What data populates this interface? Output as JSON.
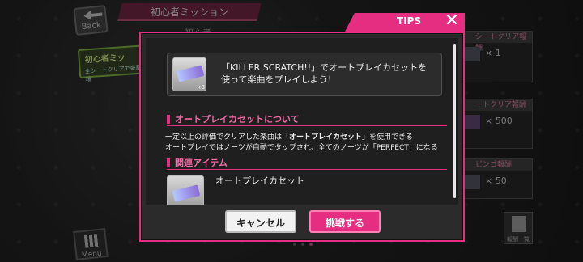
{
  "background": {
    "back_label": "Back",
    "title": "初心者ミッション",
    "subtitle": "初心者",
    "left_tag": {
      "title": "初心者ミッ",
      "sub": "全シートクリアで豪華報"
    },
    "rewards": [
      {
        "header": "シートクリア報酬",
        "value": "× 1"
      },
      {
        "header": "ートクリア報酬",
        "value": "× 500"
      },
      {
        "header": "ビンゴ報酬",
        "value": "× 50"
      }
    ],
    "menu_label": "Menu",
    "list_label": "報酬一覧"
  },
  "dialog": {
    "tips_label": "TIPS",
    "close_glyph": "✕",
    "mission": {
      "item_count": "×3",
      "line1": "「KILLER SCRATCH!!」でオートプレイカセットを",
      "line2": "使って楽曲をプレイしよう！"
    },
    "section1": {
      "heading": "オートプレイカセットについて",
      "line1_pre": "一定以上の評価でクリアした楽曲は「",
      "line1_bold": "オートプレイカセット",
      "line1_post": "」を使用できる",
      "line2": "オートプレイではノーツが自動でタップされ、全てのノーツが「PERFECT」になる"
    },
    "section2": {
      "heading": "関連アイテム",
      "item_name": "オートプレイカセット"
    },
    "cancel_label": "キャンセル",
    "confirm_label": "挑戦する"
  },
  "colors": {
    "accent": "#e52d82",
    "panel": "#2b2b2b"
  },
  "icons": [
    "back-icon",
    "close-icon",
    "cassette-icon",
    "menu-icon",
    "reward-list-icon"
  ]
}
